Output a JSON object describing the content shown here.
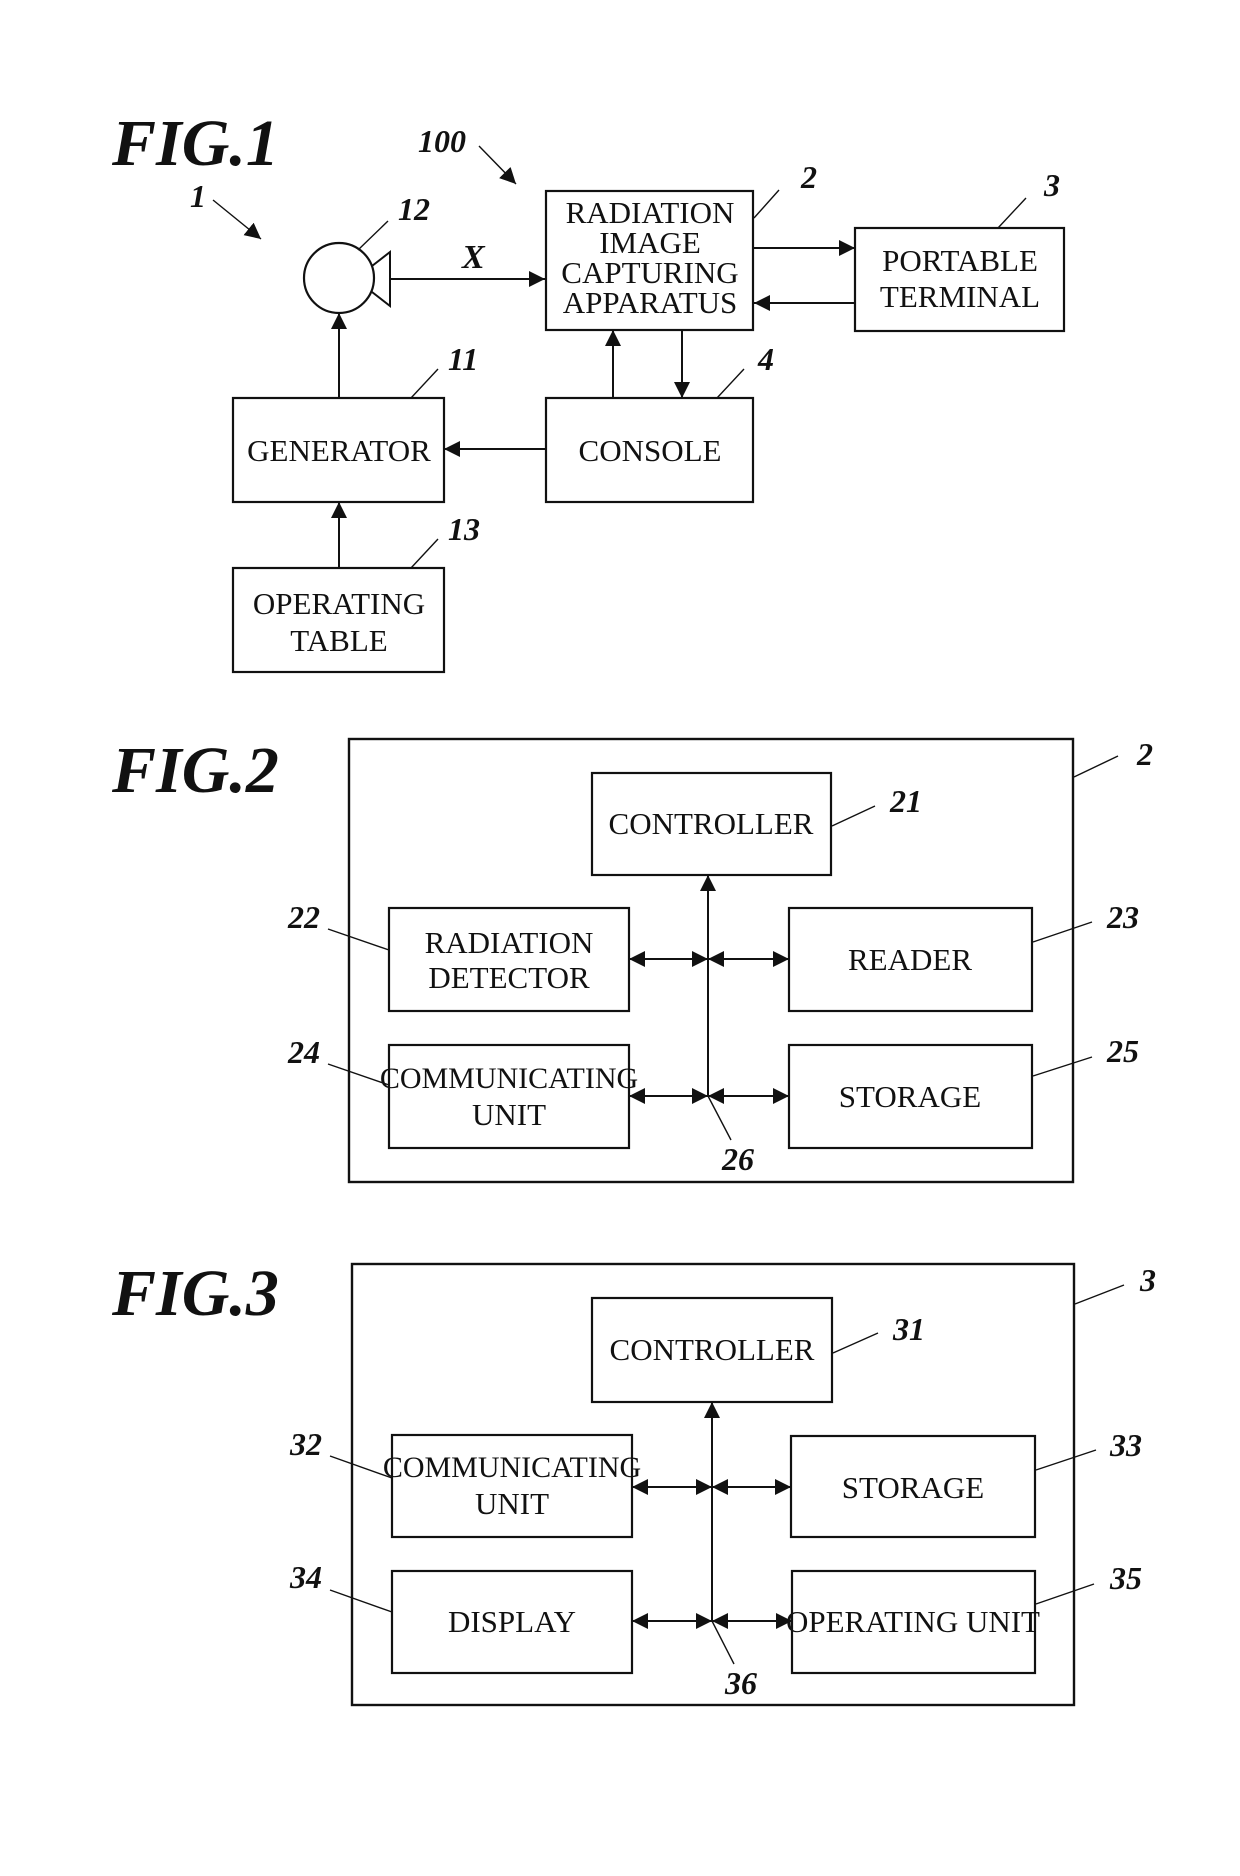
{
  "figures": {
    "fig1": {
      "title": "FIG.1",
      "system_ref": "100",
      "subsystem_ref": "1",
      "radiation_label": "X",
      "blocks": {
        "radiation_image_capturing_apparatus": {
          "ref": "2",
          "lines": [
            "RADIATION",
            "IMAGE",
            "CAPTURING",
            "APPARATUS"
          ]
        },
        "portable_terminal": {
          "ref": "3",
          "lines": [
            "PORTABLE",
            "TERMINAL"
          ]
        },
        "console": {
          "ref": "4",
          "lines": [
            "CONSOLE"
          ]
        },
        "generator": {
          "ref": "11",
          "lines": [
            "GENERATOR"
          ]
        },
        "radiation_source": {
          "ref": "12"
        },
        "operating_table": {
          "ref": "13",
          "lines": [
            "OPERATING",
            "TABLE"
          ]
        }
      }
    },
    "fig2": {
      "title": "FIG.2",
      "container_ref": "2",
      "bus_ref": "26",
      "blocks": {
        "controller": {
          "ref": "21",
          "lines": [
            "CONTROLLER"
          ]
        },
        "radiation_detector": {
          "ref": "22",
          "lines": [
            "RADIATION",
            "DETECTOR"
          ]
        },
        "reader": {
          "ref": "23",
          "lines": [
            "READER"
          ]
        },
        "communicating_unit": {
          "ref": "24",
          "lines": [
            "COMMUNICATING",
            "UNIT"
          ]
        },
        "storage": {
          "ref": "25",
          "lines": [
            "STORAGE"
          ]
        }
      }
    },
    "fig3": {
      "title": "FIG.3",
      "container_ref": "3",
      "bus_ref": "36",
      "blocks": {
        "controller": {
          "ref": "31",
          "lines": [
            "CONTROLLER"
          ]
        },
        "communicating_unit": {
          "ref": "32",
          "lines": [
            "COMMUNICATING",
            "UNIT"
          ]
        },
        "storage": {
          "ref": "33",
          "lines": [
            "STORAGE"
          ]
        },
        "display": {
          "ref": "34",
          "lines": [
            "DISPLAY"
          ]
        },
        "operating_unit": {
          "ref": "35",
          "lines": [
            "OPERATING UNIT"
          ]
        }
      }
    }
  }
}
